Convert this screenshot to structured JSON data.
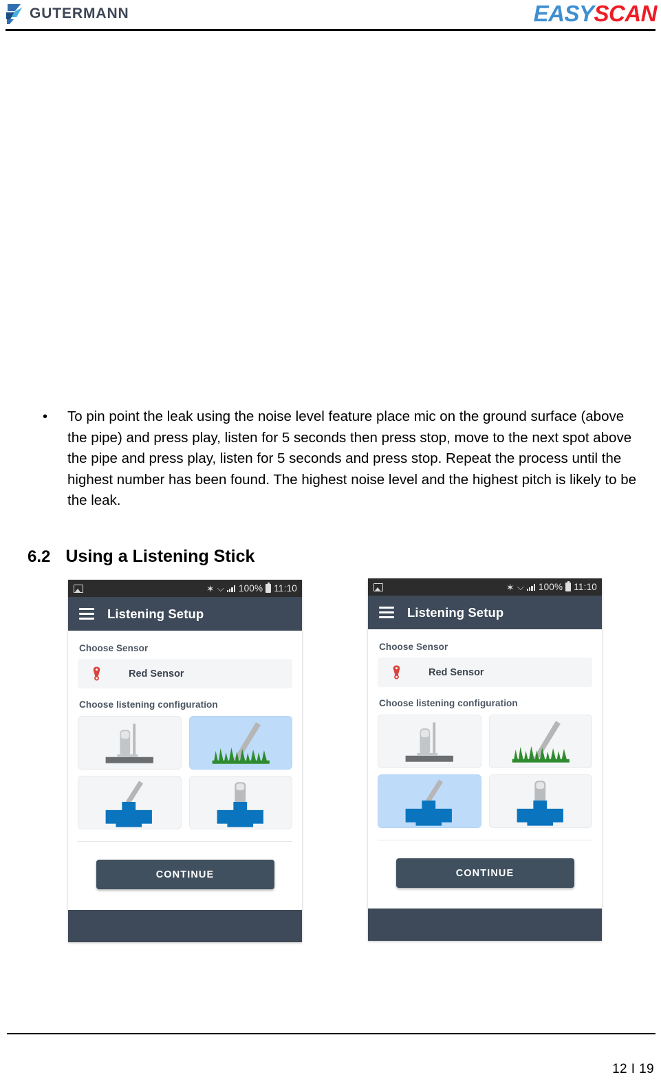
{
  "document": {
    "header": {
      "brand_left": "GUTERMANN",
      "brand_right_part1": "EASY",
      "brand_right_part2": "SCAN",
      "logo_icon": "gutermann-mark-icon"
    },
    "bullet": {
      "marker": "•",
      "text": "To pin point the leak using the noise level feature place mic on the ground surface (above the pipe) and press play, listen for 5 seconds then press stop, move to the next spot above the pipe and press play, listen for 5 seconds and press stop. Repeat the process until the highest number has been found. The highest noise level and the highest pitch is likely to be the leak."
    },
    "section": {
      "number": "6.2",
      "title": "Using a Listening Stick"
    },
    "footer": {
      "page_number": "12 I 19"
    }
  },
  "colors": {
    "status_bar": "#2c2c2c",
    "app_bar": "#3e4a59",
    "tile_default": "#f4f5f6",
    "tile_selected": "#bedcfa",
    "continue_button": "#40505f",
    "sensor_red": "#d9453c",
    "valve_blue": "#0a74bf",
    "grass_green": "#2e8b2e",
    "brand_blue": "#3d8fd1",
    "brand_red": "#ee1c25"
  },
  "screenshots": [
    {
      "id": "listening-setup-grass-selected",
      "status_bar": {
        "image_icon": "image-icon",
        "bluetooth_icon": "bluetooth-icon",
        "wifi_icon": "wifi-icon",
        "signal_icon": "signal-icon",
        "battery_percent": "100%",
        "battery_icon": "battery-icon",
        "time": "11:10"
      },
      "app_bar": {
        "menu_icon": "hamburger-menu-icon",
        "title": "Listening Setup"
      },
      "sensor_section": {
        "label": "Choose Sensor",
        "icon": "red-sensor-pin-icon",
        "value": "Red Sensor"
      },
      "config_section": {
        "label": "Choose listening configuration",
        "tiles": [
          {
            "name": "ground-microphone-on-plate",
            "selected": false
          },
          {
            "name": "listening-stick-in-grass",
            "selected": true
          },
          {
            "name": "listening-stick-on-valve",
            "selected": false
          },
          {
            "name": "microphone-on-valve",
            "selected": false
          }
        ]
      },
      "continue_label": "CONTINUE"
    },
    {
      "id": "listening-setup-valve-stick-selected",
      "status_bar": {
        "image_icon": "image-icon",
        "bluetooth_icon": "bluetooth-icon",
        "wifi_icon": "wifi-icon",
        "signal_icon": "signal-icon",
        "battery_percent": "100%",
        "battery_icon": "battery-icon",
        "time": "11:10"
      },
      "app_bar": {
        "menu_icon": "hamburger-menu-icon",
        "title": "Listening Setup"
      },
      "sensor_section": {
        "label": "Choose Sensor",
        "icon": "red-sensor-pin-icon",
        "value": "Red Sensor"
      },
      "config_section": {
        "label": "Choose listening configuration",
        "tiles": [
          {
            "name": "ground-microphone-on-plate",
            "selected": false
          },
          {
            "name": "listening-stick-in-grass",
            "selected": false
          },
          {
            "name": "listening-stick-on-valve",
            "selected": true
          },
          {
            "name": "microphone-on-valve",
            "selected": false
          }
        ]
      },
      "continue_label": "CONTINUE"
    }
  ]
}
